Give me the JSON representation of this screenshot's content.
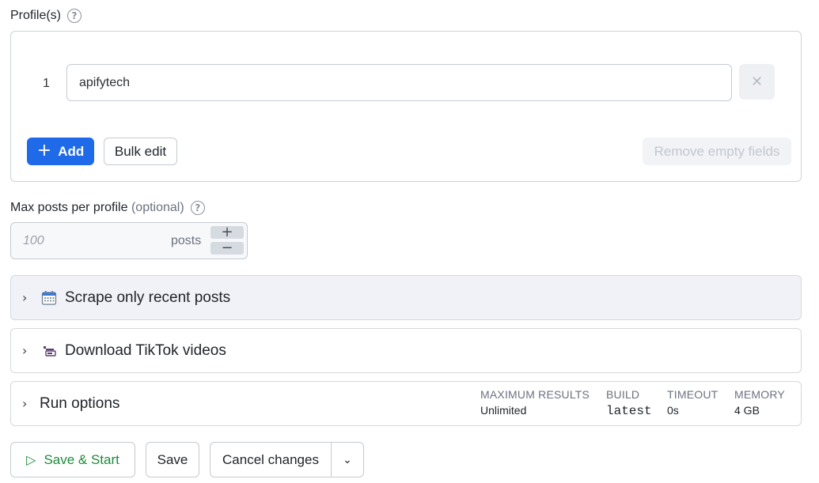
{
  "profiles": {
    "label": "Profile(s)",
    "items": [
      {
        "index": "1",
        "value": "apifytech"
      }
    ],
    "add_label": "Add",
    "bulk_edit_label": "Bulk edit",
    "remove_empty_label": "Remove empty fields"
  },
  "max_posts": {
    "label": "Max posts per profile",
    "optional": "(optional)",
    "placeholder": "100",
    "unit": "posts"
  },
  "sections": [
    {
      "title": "Scrape only recent posts",
      "icon": "calendar-icon"
    },
    {
      "title": "Download TikTok videos",
      "icon": "video-download-icon"
    },
    {
      "title": "Run options",
      "icon": "chevron-right-icon"
    }
  ],
  "run_options": {
    "max_results_head": "MAXIMUM RESULTS",
    "max_results_val": "Unlimited",
    "build_head": "BUILD",
    "build_val": "latest",
    "timeout_head": "TIMEOUT",
    "timeout_val": "0s",
    "memory_head": "MEMORY",
    "memory_val": "4 GB"
  },
  "footer": {
    "save_start_label": "Save & Start",
    "save_label": "Save",
    "cancel_label": "Cancel changes"
  },
  "colors": {
    "primary": "#1e6ae9",
    "success": "#1d8a3a",
    "highlight_bg": "#f1f2f8"
  }
}
